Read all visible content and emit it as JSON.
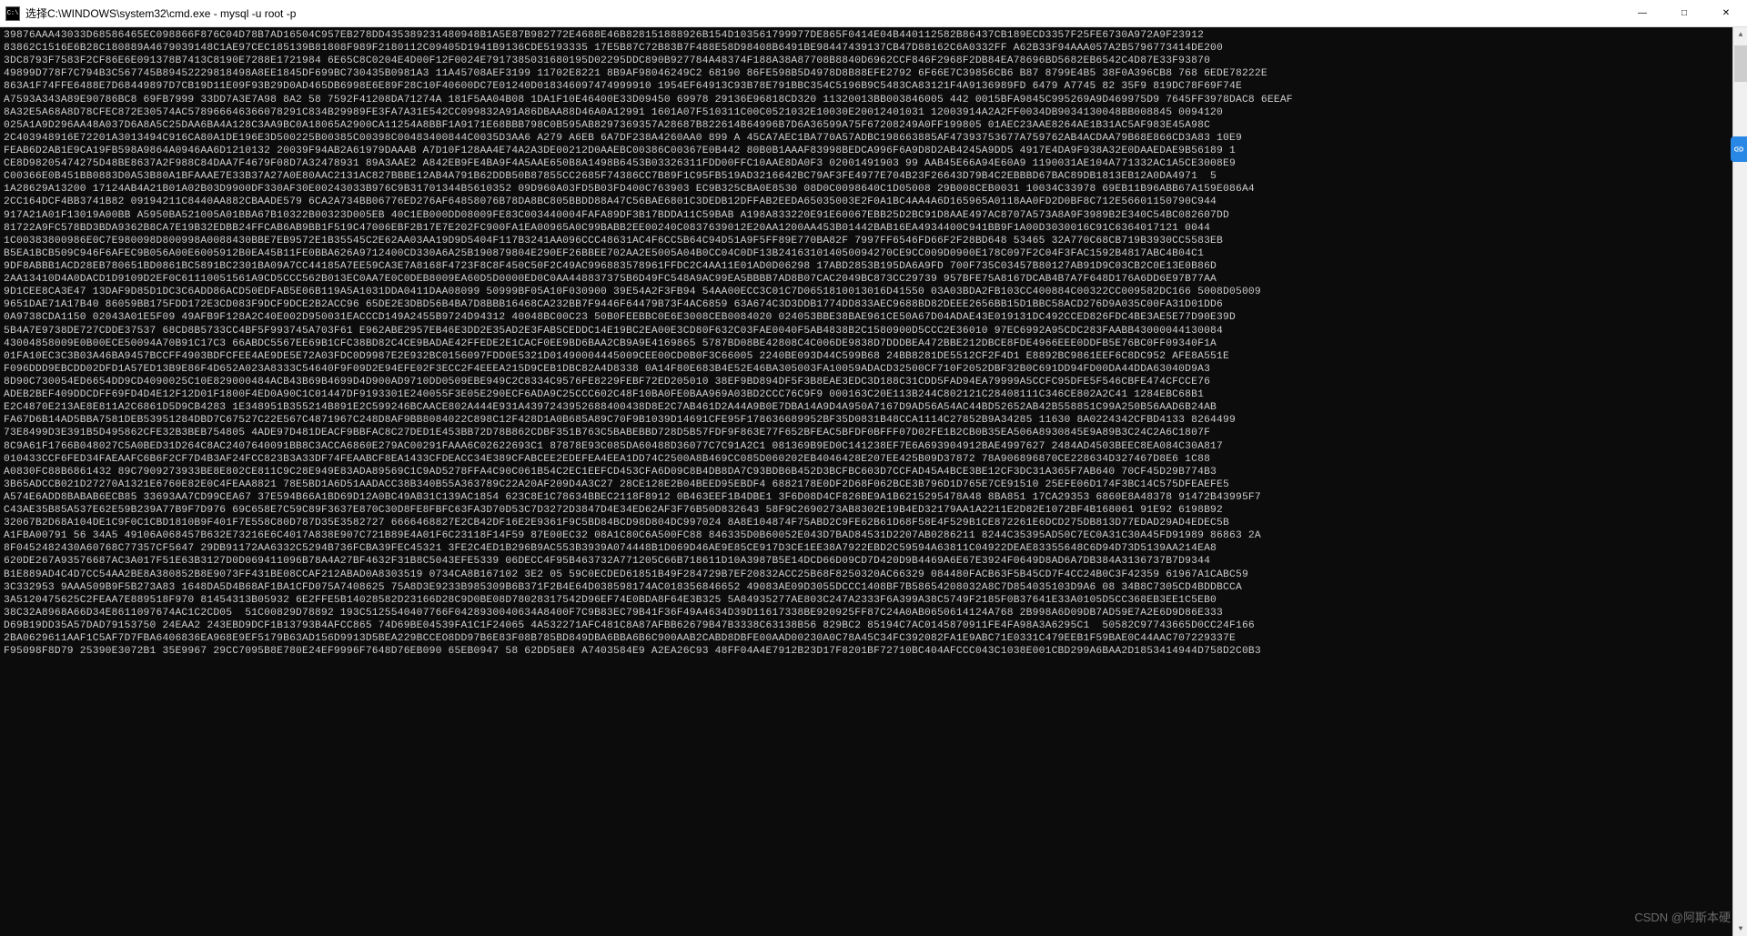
{
  "titlebar": {
    "icon_label": "C:\\",
    "title": "选择C:\\WINDOWS\\system32\\cmd.exe - mysql  -u root -p",
    "minimize": "—",
    "maximize": "□",
    "close": "✕"
  },
  "hex_lines": [
    "39876AAA43033D68586465EC098866F876C04D78B7AD16504C957EB278DD435389231480948B1A5E87B982772E4688E46B828151888926B154D103561799977DE865F0414E04B440112582B86437CB189ECD3357F25FE6730A972A9F23912",
    "83862C1516E6B28C180889A4679039148C1AE97CEC185139B81808F989F2180112C09405D1941B9136CDE5193335 17E5B87C72B83B7F488E58D98408B6491BE98447439137CB47D88162C6A0332FF A62B33F94AAA057A2B5796773414DE200",
    "3DC8793F7583F2CF86E6E091378B7413C8190E7288E1721984 6E65C8C0204E4D00F12F0024E7917385031680195D02295DDC890B927784A48374F188A38A87708B8840D6962CCF846F2968F2DB84EA78696BD5682EB6542C4D87E33F93870",
    "49899D778F7C794B3C567745B89452229818498A8EE1845DF699BC730435B0981A3 11A45708AEF3199 11702E8221 8B9AF98046249C2 68190 86FE598B5D4978D8B88EFE2792 6F66E7C39856CB6 B87 8799E4B5 38F0A396CB8 768 6EDE78222E",
    "863A1F74FFE6488E7D68449897D7CB19D11E09F93B29D0AD465DB6998E6E89F28C10F40600DC7E01240D018346097474999910 1954EF64913C93B78E791BBC354C5196B9C5483CA83121F4A9136989FD 6479 A7745 82 35F9 819DC78F69F74E",
    "A7593A343A89E90786BC8 69FB7999 33DD7A3E7A98 8A2 58 7592F41208DA71274A 181F5AA04B08 1DA1F10E46400E33D09450 69978 29136E96818CD320 11320013BB003846005 442 0015BFA9845C995269A9D469975D9 7645FF3978DAC8 6EEAF",
    "8A32E5A68A8D78CFEC872E30574AC578966646366078291C834B29989FE3FA7A31E542CC099832A91A86DBAA88D46A0A12991 1601A07F510311C00C0521032E10030E20012401031 12003914A2A2FF0034DB9034130048BB008845 0094120",
    "025A1A9D296AA48A037D6A8A5C25DAA6BA4A128C3AA9BC0A18065A2900CA11254A8BBF1A9171E68BBB798C0B595AB8297369357A28687B822614B64996B7D6A36599A75F67208249A0FF199805 01AEC23AAE8264AE1B31AC5AF983E45A98C",
    "2C403948916E72201A3013494C916CA80A1DE196E3D500225B00385C00398C00483400844C0035D3AA6 A279 A6EB 6A7DF238A4260AA0 899 A 45CA7AEC1BA770A57ADBC198663885AF47393753677A759762AB4ACDAA79B68E866CD3A83 10E9",
    "FEAB6D2AB1E9CA19FB598A9864A0946AA6D1210132 20039F94AB2A61979DAAAB A7D10F128AA4E74A2A3DE00212D0AAEBC00386C00367E0B442 80B0B1AAAF83998BEDCA996F6A9D8D2AB4245A9DD5 4917E4DA9F938A32E0DAAEDAE9B56189 1",
    "CE8D98205474275D48BE8637A2F988C84DAA7F4679F08D7A32478931 89A3AAE2 A842EB9FE4BA9F4A5AAE650B8A1498B6453B03326311FDD00FFC10AAE8DA0F3 02001491903 99 AAB45E66A94E60A9 1190031AE104A771332AC1A5CE3008E9",
    "C00366E0B451BB0883D0A53B80A1BFAAAE7E33B37A27A0E80AAC2131AC827BBBE12AB4A791B62DDB50B87855CC2685F74386CC7B89F1C95FB519AD3216642BC79AF3FE4977E704B23F26643D79B4C2EBBBD67BAC89DB1813EB12A0DA4971  5",
    "1A28629A13200 17124AB4A21B01A02B03D9900DF330AF30E00243033B976C9B31701344B5610352 09D960A03FD5B03FD400C763903 EC9B325CBA0E8530 08D0C0098640C1D05008 29B008CEB0031 10034C33978 69EB11B96ABB67A159E086A4",
    "2CC164DCF4BB3741B82 09194211C8440AA882CBAADE579 6CA2A734BB06776ED276AF64858076B78DA8BC805BBDD88A47C56BAE6801C3DEDB12DFFAB2EEDA65035003E2F0A1BC4AA4A6D165965A0118AA0FD2D0BF8C712E56601150790C944",
    "917A21A01F13019A00BB A5950BA521005A01BBA67B10322B00323D005EB 40C1EB000DD08009FE83C003440004FAFA89DF3B17BDDA11C59BAB A198A833220E91E60067EBB25D2BC91D8AAE497AC8707A573A8A9F3989B2E340C54BC082607DD",
    "81722A9FC578BD3BDA9362B8CA7E19B32EDBB24FFCAB6AB9BB1F519C47006EBF2B17E7E202FC900FA1EA00965A0C99BABB2EE00240C0837639012E20AA1200AA453B01442BAB16EA4934400C941BB9F1A00D3030016C91C6364017121 0044",
    "1C00383800986E0C7E980098D800998A0088430BBE7EB9572E1B35545C2E62AA03AA19D9D5404F117B3241AA096CCC48631AC4F6CC5B64C94D51A9F5FF89E770BA82F 7997FF6546FD66F2F28BD648 53465 32A770C68CB719B3930CC5583EB",
    "B5EA1BCB509C946F6AFEC9B056A00E6005912B0EA45B11FE0BBA626A9712400CD330A6A25B190879804E290EF26BBEE702AA2E5005A04B0CC04C0DF13B241631014050094270CE9CC009D0900E178C097F2C04F3FAC1592B4817ABC4B04C1",
    "9DF8ABBB1ACD28EB780651BD0861BC5891BC2301BA09A7CC44185A7EE59CA3E7A8168F4723F8C8F450C50F2C49AC996883578961FFDC2C4AA11E01AD0D06298 17ABD2853B195DA6A9FD 700F735C03457B80127AB91D9C03CB2C0E13E0B86D",
    "2AA13410D4A0DACD1D9109D2EF0C61110051561A9CD5CCC562B013EC0AA7E0C0DEB8009EA60D5D0000ED0C0AA448837375B6D49FC548A9AC99EA5BBBB7AD8B07CAC2049BC873CC29739 957BFE75A8167DCAB4B7A7F648D176A6DD6E97B77AA",
    "9D1CEE8CA3E47 13DAF9D85D1DC3C6ADD86ACD50EDFAB5E06B119A5A1031DDA0411DAA08099 50999BF05A10F030900 39E54A2F3FB94 54AA00ECC3C01C7D0651810013016D41550 03A03BDA2FB103CC400884C00322CC009582DC166 5008D05009",
    "9651DAE71A17B40 86059BB175FDD172E3CD083F9DCF9DCE2B2ACC96 65DE2E3DBD56B4BA7D8BBB16468CA232BB7F9446F64479B73F4AC6859 63A674C3D3DDB1774DD833AEC9688BD82DEEE2656BB15D1BBC58ACD276D9A035C00FA31D01DD6",
    "0A9738CDA1150 02043A01E5F09 49AFB9F128A2C40E002D950031EACCCD149A2455B9724D94312 40048BC00C23 50B0FEEBBC0E6E3008CEB0084020 024053BBE38BAE961CE50A67D04ADAE43E019131DC492CCED826FDC4BE3AE5E77D90E39D",
    "5B4A7E9738DE727CDDE37537 68CD8B5733CC4BF5F993745A703F61 E962ABE2957EB46E3DD2E35AD2E3FAB5CEDDC14E19BC2EA00E3CD80F632C03FAE0040F5AB4838B2C1580900D5CCC2E36010 97EC6992A95CDC283FAABB43000044130084",
    "43004858009E0B00ECE50094A70B91C17C3 66ABDC5567EE69B1CFC38BD82C4CE9BADAE42FFEDE2E1CACF0EE9BD6BAA2CB9A9E4169865 5787BD08BE42808C4C006DE9838D7DDDBEA472BBE212DBCE8FDE4966EEE0DDFB5E76BC0FF09340F1A",
    "01FA10EC3C3B03A46BA9457BCCFF4903BDFCFEE4AE9DE5E72A03FDC0D9987E2E932BC0156097FDD0E5321D01490004445009CEE00CD0B0F3C66005 2240BE093D44C599B68 24BB8281DE5512CF2F4D1 E8892BC9861EEF6C8DC952 AFE8A551E",
    "F096DDD9EBCDD02DFD1A57ED13B9E86F4D652A023A8333C54640F9F09D2E94EFE02F3ECC2F4EEEA215D9CEB1DBC82A4D8338 0A14F80E683B4E52E46BA305003FA10059ADACD32500CF710F2052DBF32B0C691DD94FD00DA44DDA63040D9A3",
    "8D90C730054ED6654DD9CD4090025C10E829000484ACB43B69B4699D4D900AD9710DD0509EBE949C2C8334C9576FE8229FEBF72ED205010 38EF9BD894DF5F3B8EAE3EDC3D188C31CDD5FAD94EA79999A5CCFC95DFE5F546CBFE474CFCCE76",
    "ADEB2BEF409DDCDFF69FD4D4E12F12D01F1800F4ED0A90C1C01447DF9193301E240055F3E05E290ECF6ADA9C25CCC602C48F10BA0FE0BAA969A03BD2CCC76C9F9 000163C20E113B244C802121C28408111C346CE802A2C41 1284EBC68B1",
    "E2C4870E213AE8E811A2C6861D5D9CB4283 1E348951B355214B891E2C599246BCAACE802A444E931A4397243952688400438D8E2C7AB461D2A44A9B0E7DBA14A9D4A950A7167D9AD56A54AC44BD52652AB42B558851C99A250B56AAD6B24AB",
    "FA67D6B14AD5BBA7581DEB53951284DBD7C67527C22E567C4871967C248D8AF9BB8084022C898C12F428D1A0B685A89C70F9B1039D14691CFE95F178636689952BF35D0831B48CCA1114C27852B9A34285 11630 8A0224342CFBD4133 8264499",
    "73E8499D3E391B5D495862CFE32B3BEB754805 4ADE97D481DEACF9BBFAC8C27DED1E453BB72D78B862CDBF351B763C5BABEBBD728D5B57FDF9F863E77F652BFEAC5BFDF0BFFF07D02FE1B2CB0B35EA506A8930845E9A89B3C24C2A6C1807F",
    "8C9A61F1766B048027C5A0BED31D264C8AC2407640091BB8C3ACCA6860E279AC00291FAAA6C02622693C1 87878E93C085DA60488D36077C7C91A2C1 081369B9ED0C141238EF7E6A693904912BAE4997627 2484AD4503BEEC8EA084C30A817",
    "010433CCF6FED34FAEAAFC6B6F2CF7D4B3AF24FCC823B3A33DF74FEAABCF8EA1433CFDEACC34E389CFABCEE2EDEFEA4EEA1DD74C2500A8B469CC085D060202EB4046428E207EE425B09D37872 78A906896870CE228634D327467D8E6 1C88",
    "A0830FC88B6861432 89C7909273933BE8E802CE811C9C28E949E83ADA89569C1C9AD5278FFA4C90C061B54C2EC1EEFCD453CFA6D09C8B4DB8DA7C93BDB6B452D3BCFBC603D7CCFAD45A4BCE3BE12CF3DC31A365F7AB640 70CF45D29B774B3",
    "3B65ADCCB021D27270A1321E6760E82E0C4FEAA8821 78E5BD1A6D51AADACC38B340B55A363789C22A20AF209D4A3C27 28CE128E2B04BEED95EBDF4 6882178E0DF2D68F062BCE3B796D1D765E7CE91510 25EFE06D174F3BC14C575DFEAEFE5",
    "A574E6ADD8BABAB6ECB85 33693AA7CD99CEA67 37E594B66A1BD69D12A0BC49AB31C139AC1854 623C8E1C78634BBEC2118F8912 0B463EEF1B4DBE1 3F6D08D4CF826BE9A1B6215295478A48 8BA851 17CA29353 6860E8A48378 91472B43995F7",
    "C43AE35B85A537E62E59B239A77B9F7D976 69C658E7C59C89F3637E870C30D8FE8FBFC63FA3D70D53C7D3272D3847D4E34ED62AF3F76B50D832643 58F9C2690273AB8302E19B4ED32179AA1A2211E2D82E1072BF4B168061 91E92 6198B92",
    "32067B2D68A104DE1C9F0C1CBD1810B9F401F7E558C80D787D35E3582727 6666468827E2CB42DF16E2E9361F9C5BD84BCD98D804DC997024 8A8E104874F75ABD2C9FE62B61D68F58E4F529B1CE872261E6DCD275DB813D77EDAD29AD4EDEC5B",
    "A1FBA00791 56 34A5 49106A068457B632E73216E6C4017A838E907C721B89E4A01F6C23118F14F59 87E00EC32 08A1C80C6A500FC88 846335D0B60052E043D7BAD84531D2207AB0286211 8244C35395AD50C7EC0A31C30A45FD91989 86863 2A",
    "8F0452482430A60768C77357CF5647 29DB91172AA6332C5294B736FCBA39FEC45321 3FE2C4ED1B296B9AC553B3939A074448B1D069D46AE9E85CE917D3CE1EE38A7922EBD2C59594A63811C04922DEAE83355648C6D94D73D5139AA214EA8",
    "620DE267A93576687AC3A017F51E63B3127D0D069411096B78A4A27BF4632F31B8C5043EFE5339 06DECC4F95B463732A771205C66B718611D10A3987B5E14DCD66D09CD7D420D9B4469A6E67E3924F0649D8AD6A7DB384A3136737B7D9344",
    "B1E889AD4C4D7CC54AA2BE8A380852B8E9073FF431BE08CCAF212ABAD0A8303519 0734CA8B167102 3E2 05 59C0ECDED61851B49F284729B7EF20832ACC25B68F8250320AC66329 084480FACB63F5B45CD7F4CC24B0C3F42359 61967A1CABC59",
    "3C332953 9AAA509B9F5B273A83 1648DA5D4B68AF1BA1CFD075A7408625 75A8D3E9233B985309B6B371F2B4E64D038598174AC018356846652 49083AE09D3055DCCC1408BF7B58654208032A8C7D854035103D9A6 08 34B8C7305CD4BDDBCCA",
    "3A5120475625C2FEAA7E889518F970 81454313B05932 6E2FFE5B14028582D23166D28C9D0BE08D78028317542D96EF74E0BDA8F64E3B325 5A84935277AE803C247A2333F6A399A38C5749F2185F0B37641E33A0105D5CC368EB3EE1C5EB0",
    "38C32A8968A66D34E8611097674AC1C2CD05  51C00829D78892 193C5125540407766F0428930040634A8400F7C9B83EC79B41F36F49A4634D39D11617338BE920925FF87C24A0AB0650614124A768 2B998A6D09DB7AD59E7A2E6D9D86E333",
    "D69B19DD35A57DAD79153750 24EAA2 243EBD9DCF1B13793B4AFCC865 74D69BE04539FA1C1F24065 4A532271AFC481C8A87AFBB62679B47B3338C63138B56 829BC2 85194C7AC0145870911FE4FA98A3A6295C1  50582C97743665D0CC24F166",
    "2BA0629611AAF1C5AF7D7FBA6406836EA968E9EF5179B63AD156D9913D5BEA229BCCEO8DD97B6E83F08B785BD849DBA6BBA6B6C900AAB2CABD8DBFE00AAD00230A0C78A45C34FC392082FA1E9ABC71E0331C479EEB1F59BAE0C44AAC707229337E",
    "F95098F8D79 25390E3072B1 35E9967 29CC7095B8E780E24EF9996F7648D76EB090 65EB0947 58 62DD58E8 A7403584E9 A2EA26C93 48FF04A4E7912B23D17F8201BF72710BC404AFCCC043C1038E001CBD299A6BAA2D1853414944D758D2C0B3"
  ],
  "watermark": "CSDN @阿斯本硬",
  "scrollbar": {
    "up": "▲",
    "down": "▼"
  }
}
